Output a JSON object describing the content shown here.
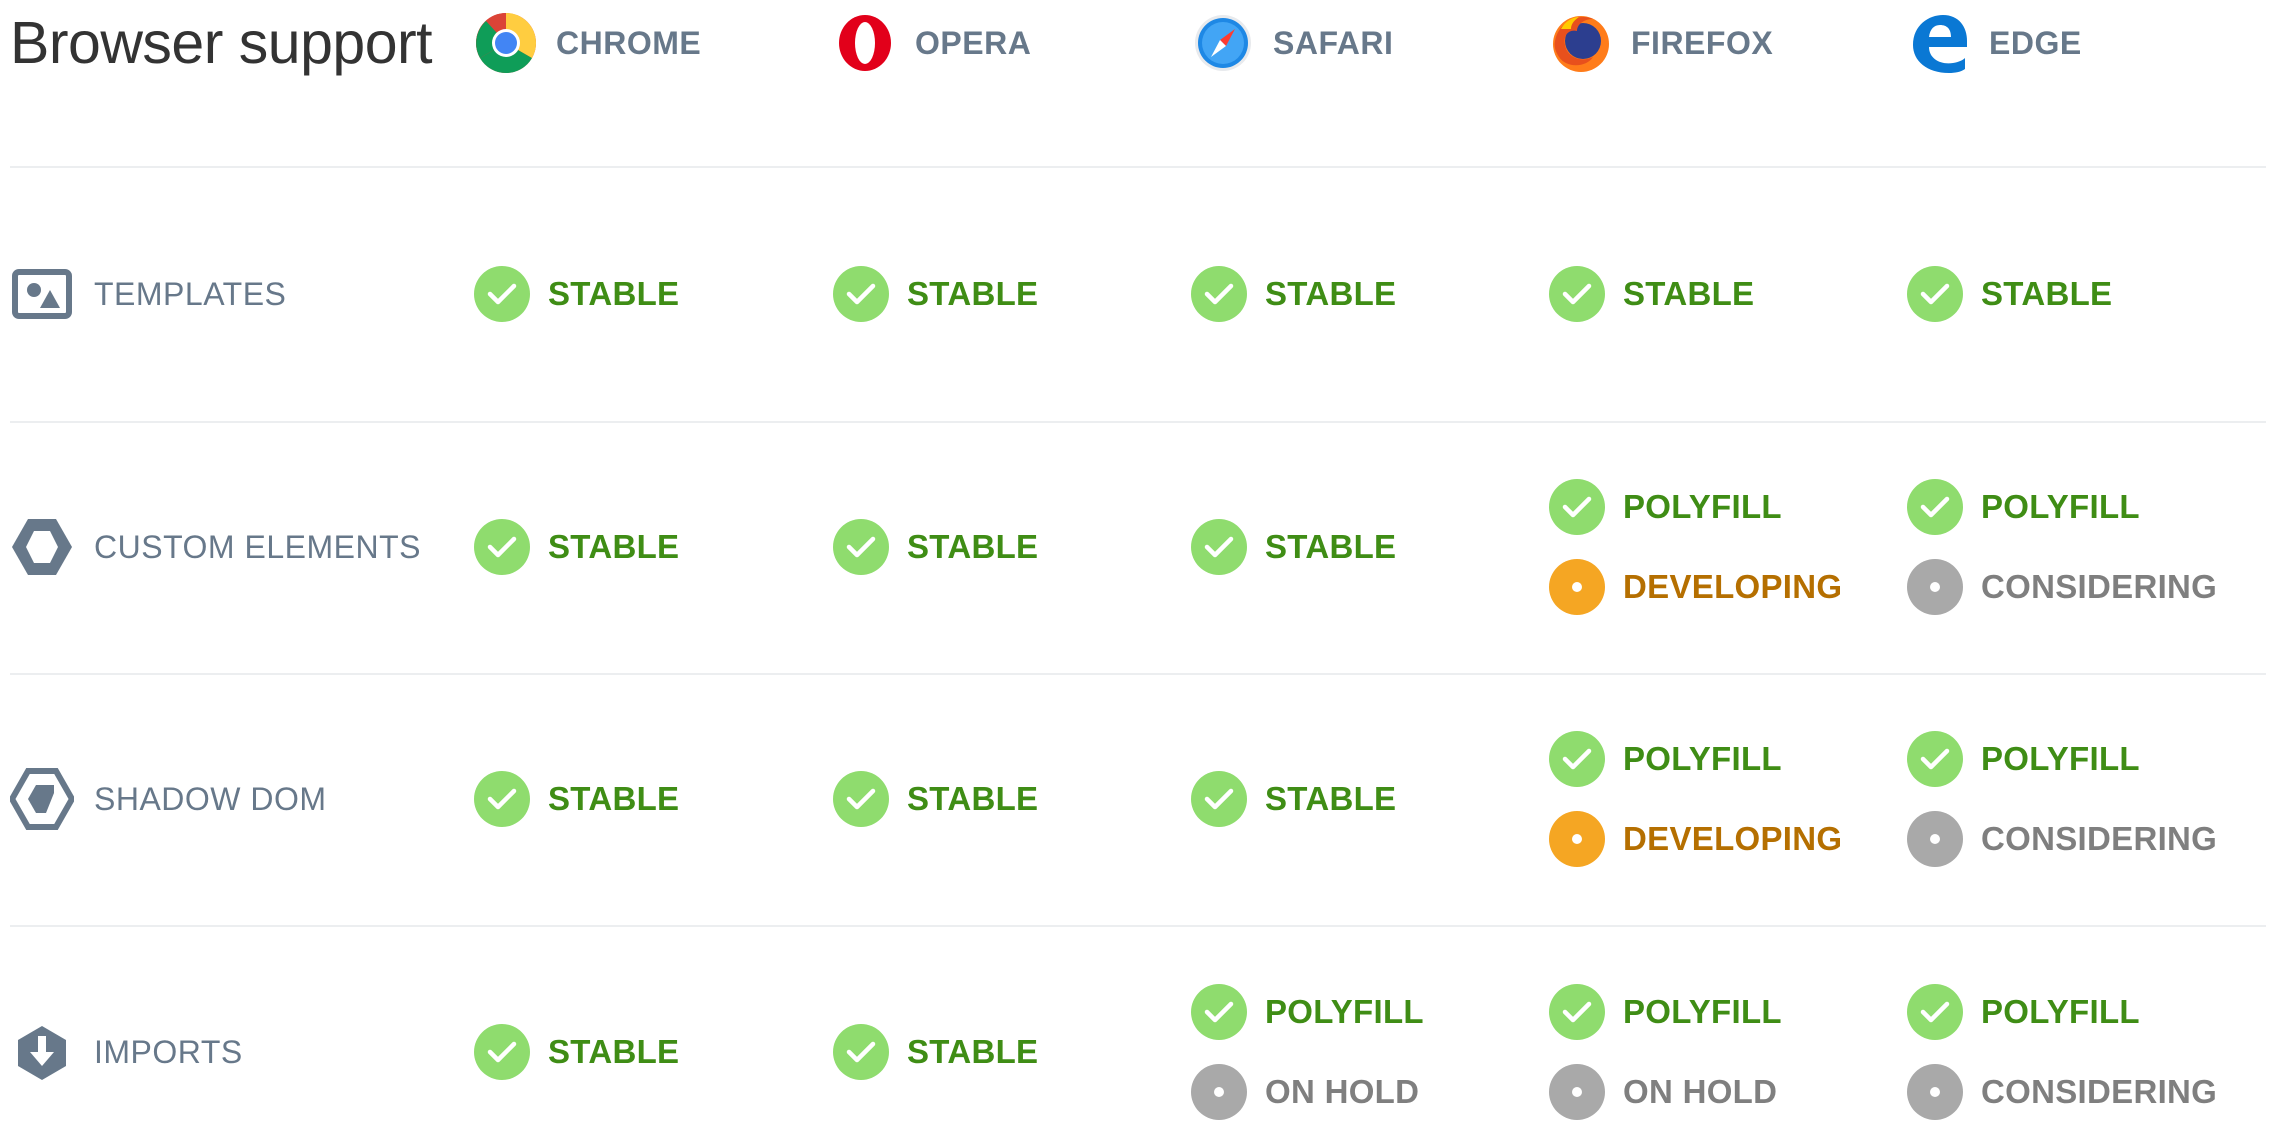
{
  "title": "Browser support",
  "browsers": [
    {
      "key": "chrome",
      "name": "CHROME"
    },
    {
      "key": "opera",
      "name": "OPERA"
    },
    {
      "key": "safari",
      "name": "SAFARI"
    },
    {
      "key": "firefox",
      "name": "FIREFOX"
    },
    {
      "key": "edge",
      "name": "EDGE"
    }
  ],
  "status_colors": {
    "stable": "#8fdc6e",
    "developing": "#f5a623",
    "considering": "#a9a9a9",
    "text_green": "#3f8d15",
    "text_orange": "#b56f00",
    "text_gray": "#7f7f7f"
  },
  "features": [
    {
      "name": "TEMPLATES",
      "icon": "templates-icon",
      "cells": [
        [
          {
            "type": "stable",
            "label": "STABLE"
          }
        ],
        [
          {
            "type": "stable",
            "label": "STABLE"
          }
        ],
        [
          {
            "type": "stable",
            "label": "STABLE"
          }
        ],
        [
          {
            "type": "stable",
            "label": "STABLE"
          }
        ],
        [
          {
            "type": "stable",
            "label": "STABLE"
          }
        ]
      ]
    },
    {
      "name": "CUSTOM ELEMENTS",
      "icon": "custom-elements-icon",
      "cells": [
        [
          {
            "type": "stable",
            "label": "STABLE"
          }
        ],
        [
          {
            "type": "stable",
            "label": "STABLE"
          }
        ],
        [
          {
            "type": "stable",
            "label": "STABLE"
          }
        ],
        [
          {
            "type": "polyfill",
            "label": "POLYFILL"
          },
          {
            "type": "developing",
            "label": "DEVELOPING"
          }
        ],
        [
          {
            "type": "polyfill",
            "label": "POLYFILL"
          },
          {
            "type": "considering",
            "label": "CONSIDERING"
          }
        ]
      ]
    },
    {
      "name": "SHADOW DOM",
      "icon": "shadow-dom-icon",
      "cells": [
        [
          {
            "type": "stable",
            "label": "STABLE"
          }
        ],
        [
          {
            "type": "stable",
            "label": "STABLE"
          }
        ],
        [
          {
            "type": "stable",
            "label": "STABLE"
          }
        ],
        [
          {
            "type": "polyfill",
            "label": "POLYFILL"
          },
          {
            "type": "developing",
            "label": "DEVELOPING"
          }
        ],
        [
          {
            "type": "polyfill",
            "label": "POLYFILL"
          },
          {
            "type": "considering",
            "label": "CONSIDERING"
          }
        ]
      ]
    },
    {
      "name": "IMPORTS",
      "icon": "imports-icon",
      "cells": [
        [
          {
            "type": "stable",
            "label": "STABLE"
          }
        ],
        [
          {
            "type": "stable",
            "label": "STABLE"
          }
        ],
        [
          {
            "type": "polyfill",
            "label": "POLYFILL"
          },
          {
            "type": "onhold",
            "label": "ON HOLD"
          }
        ],
        [
          {
            "type": "polyfill",
            "label": "POLYFILL"
          },
          {
            "type": "onhold",
            "label": "ON HOLD"
          }
        ],
        [
          {
            "type": "polyfill",
            "label": "POLYFILL"
          },
          {
            "type": "considering",
            "label": "CONSIDERING"
          }
        ]
      ]
    }
  ]
}
